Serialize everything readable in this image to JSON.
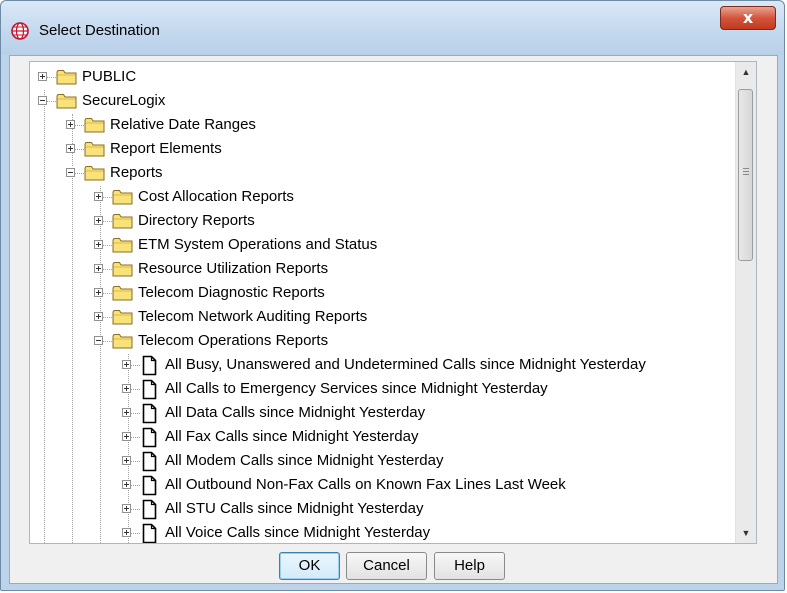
{
  "window": {
    "title": "Select Destination",
    "close_label": "x"
  },
  "tree": {
    "nodes": [
      {
        "label": "PUBLIC",
        "type": "folder",
        "expanded": false
      },
      {
        "label": "SecureLogix",
        "type": "folder",
        "expanded": true
      },
      {
        "label": "Relative Date Ranges",
        "type": "folder",
        "expanded": false
      },
      {
        "label": "Report Elements",
        "type": "folder",
        "expanded": false
      },
      {
        "label": "Reports",
        "type": "folder",
        "expanded": true
      },
      {
        "label": "Cost Allocation Reports",
        "type": "folder",
        "expanded": false
      },
      {
        "label": "Directory Reports",
        "type": "folder",
        "expanded": false
      },
      {
        "label": "ETM System Operations and Status",
        "type": "folder",
        "expanded": false
      },
      {
        "label": "Resource Utilization Reports",
        "type": "folder",
        "expanded": false
      },
      {
        "label": "Telecom Diagnostic Reports",
        "type": "folder",
        "expanded": false
      },
      {
        "label": "Telecom Network Auditing Reports",
        "type": "folder",
        "expanded": false
      },
      {
        "label": "Telecom Operations Reports",
        "type": "folder",
        "expanded": true
      },
      {
        "label": "All Busy, Unanswered and Undetermined Calls since Midnight Yesterday",
        "type": "report",
        "expanded": false
      },
      {
        "label": "All Calls to Emergency Services since Midnight Yesterday",
        "type": "report",
        "expanded": false
      },
      {
        "label": "All Data Calls since Midnight Yesterday",
        "type": "report",
        "expanded": false
      },
      {
        "label": "All Fax Calls since Midnight Yesterday",
        "type": "report",
        "expanded": false
      },
      {
        "label": "All Modem Calls since Midnight Yesterday",
        "type": "report",
        "expanded": false
      },
      {
        "label": "All Outbound Non-Fax Calls on Known Fax Lines Last Week",
        "type": "report",
        "expanded": false
      },
      {
        "label": "All STU Calls since Midnight Yesterday",
        "type": "report",
        "expanded": false
      },
      {
        "label": "All Voice Calls since Midnight Yesterday",
        "type": "report",
        "expanded": false
      }
    ]
  },
  "buttons": {
    "ok": "OK",
    "cancel": "Cancel",
    "help": "Help"
  },
  "colors": {
    "folder_fill": "#f9e27a",
    "folder_stroke": "#8a6d1d",
    "close_button": "#c2391f",
    "default_button_border": "#3c7fb1"
  },
  "icons": {
    "app": "globe-icon",
    "folder": "folder-icon",
    "report": "document-icon",
    "expand": "plus-box-icon",
    "collapse": "minus-box-icon"
  }
}
